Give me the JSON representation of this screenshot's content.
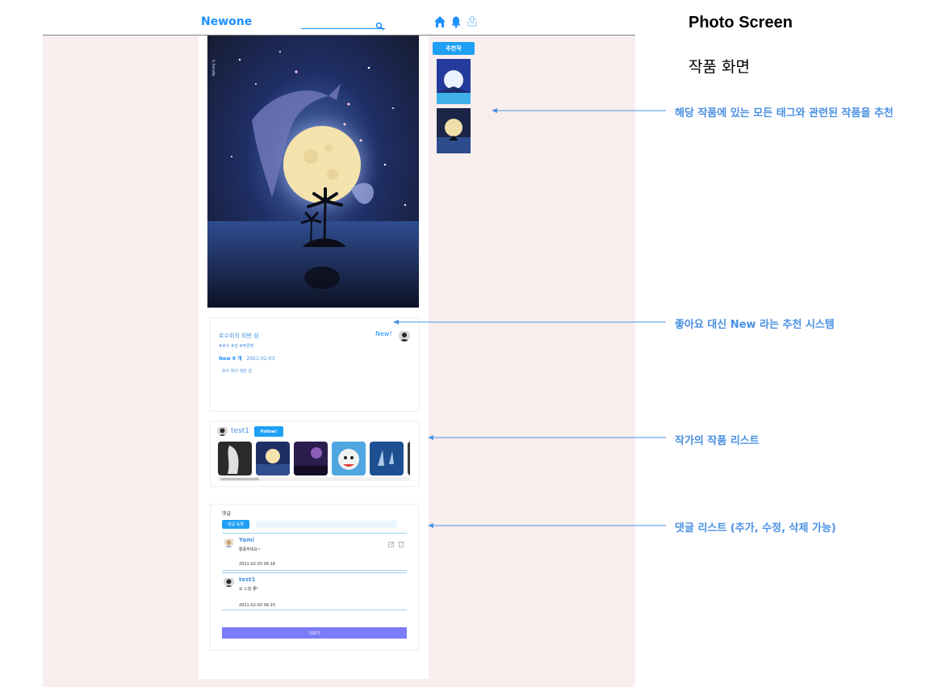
{
  "app": {
    "logo": "Newone",
    "search": {
      "value": "",
      "placeholder": ""
    },
    "nav_icons": [
      "home-icon",
      "bell-icon",
      "upload-icon"
    ]
  },
  "artwork": {
    "signature": "k.honda"
  },
  "recommend": {
    "button_label": "추천작",
    "count_shown": 2
  },
  "work_info": {
    "title": "호수위의 외딴 섬",
    "tags": "#호수 #섬 #푸른밤",
    "new_count": "New 9 개",
    "date": "2021-02-03",
    "description": "호수 위의 외딴 섬",
    "new_button": "New!"
  },
  "author": {
    "name": "test1",
    "follow_button": "Follow!",
    "works_visible": 6
  },
  "comments": {
    "title": "댓글",
    "submit_button": "댓글 등록",
    "input": {
      "value": "",
      "placeholder": ""
    },
    "items": [
      {
        "author": "Yami",
        "text": "황홀하네요~",
        "date": "2021-02-03 06:16"
      },
      {
        "author": "test1",
        "text": "오 느낌 좋!",
        "date": "2021-02-03 06:15"
      }
    ],
    "more_button": "더보기"
  },
  "annotations": {
    "title": "Photo Screen",
    "subtitle": "작품 화면",
    "notes": [
      "해당 작품에 있는 모든 태그와 관련된 작품을 추천",
      "좋아요 대신 New 라는 추천 시스템",
      "작가의 작품 리스트",
      "댓글 리스트 (추가, 수정, 삭제 가능)"
    ]
  },
  "colors": {
    "accent": "#1ea0f4",
    "link": "#4a90e2",
    "page_bg": "#f9eeee",
    "more_button": "#7b7cf7"
  }
}
